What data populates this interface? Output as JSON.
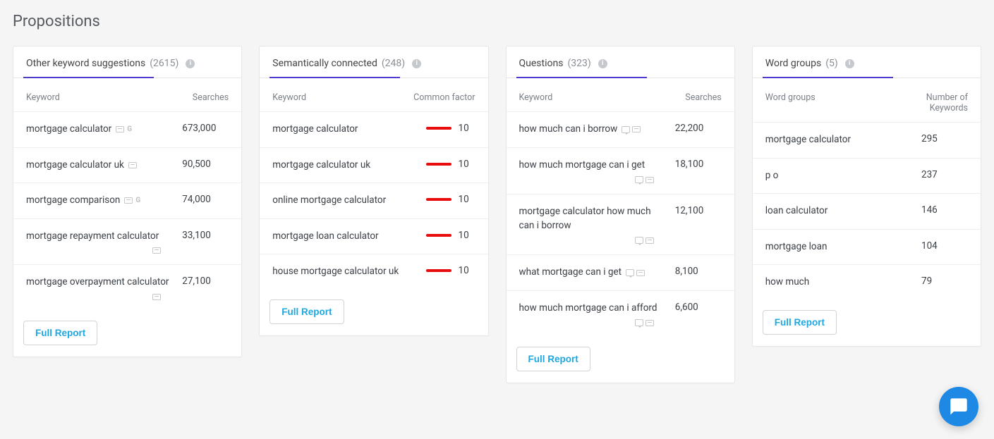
{
  "page": {
    "title": "Propositions"
  },
  "common": {
    "full_report_label": "Full Report"
  },
  "cards": {
    "other": {
      "title": "Other keyword suggestions",
      "count": "(2615)",
      "col1": "Keyword",
      "col2": "Searches",
      "rows": [
        {
          "keyword": "mortgage calculator",
          "value": "673,000",
          "icons": [
            "rect",
            "g"
          ]
        },
        {
          "keyword": "mortgage calculator uk",
          "value": "90,500",
          "icons": [
            "rect"
          ]
        },
        {
          "keyword": "mortgage comparison",
          "value": "74,000",
          "icons": [
            "rect",
            "g"
          ]
        },
        {
          "keyword": "mortgage repayment calculator",
          "value": "33,100",
          "icons": [
            "rect"
          ],
          "icons_below": true
        },
        {
          "keyword": "mortgage overpayment calculator",
          "value": "27,100",
          "icons": [
            "rect"
          ],
          "icons_below": true
        }
      ]
    },
    "semantic": {
      "title": "Semantically connected",
      "count": "(248)",
      "col1": "Keyword",
      "col2": "Common factor",
      "rows": [
        {
          "keyword": "mortgage calculator",
          "factor": "10"
        },
        {
          "keyword": "mortgage calculator uk",
          "factor": "10"
        },
        {
          "keyword": "online mortgage calculator",
          "factor": "10"
        },
        {
          "keyword": "mortgage loan calculator",
          "factor": "10"
        },
        {
          "keyword": "house mortgage calculator uk",
          "factor": "10"
        }
      ]
    },
    "questions": {
      "title": "Questions",
      "count": "(323)",
      "col1": "Keyword",
      "col2": "Searches",
      "rows": [
        {
          "keyword": "how much can i borrow",
          "value": "22,200",
          "icons": [
            "chat",
            "rect"
          ]
        },
        {
          "keyword": "how much mortgage can i get",
          "value": "18,100",
          "icons": [
            "chat",
            "rect"
          ],
          "icons_below": true
        },
        {
          "keyword": "mortgage calculator how much can i borrow",
          "value": "12,100",
          "icons": [
            "chat",
            "rect"
          ],
          "icons_below": true
        },
        {
          "keyword": "what mortgage can i get",
          "value": "8,100",
          "icons": [
            "chat",
            "rect"
          ]
        },
        {
          "keyword": "how much mortgage can i afford",
          "value": "6,600",
          "icons": [
            "chat",
            "rect"
          ],
          "icons_below": true
        }
      ]
    },
    "wordgroups": {
      "title": "Word groups",
      "count": "(5)",
      "col1": "Word groups",
      "col2": "Number of Keywords",
      "rows": [
        {
          "keyword": "mortgage calculator",
          "value": "295"
        },
        {
          "keyword": "p o",
          "value": "237"
        },
        {
          "keyword": "loan calculator",
          "value": "146"
        },
        {
          "keyword": "mortgage loan",
          "value": "104"
        },
        {
          "keyword": "how much",
          "value": "79"
        }
      ]
    }
  }
}
